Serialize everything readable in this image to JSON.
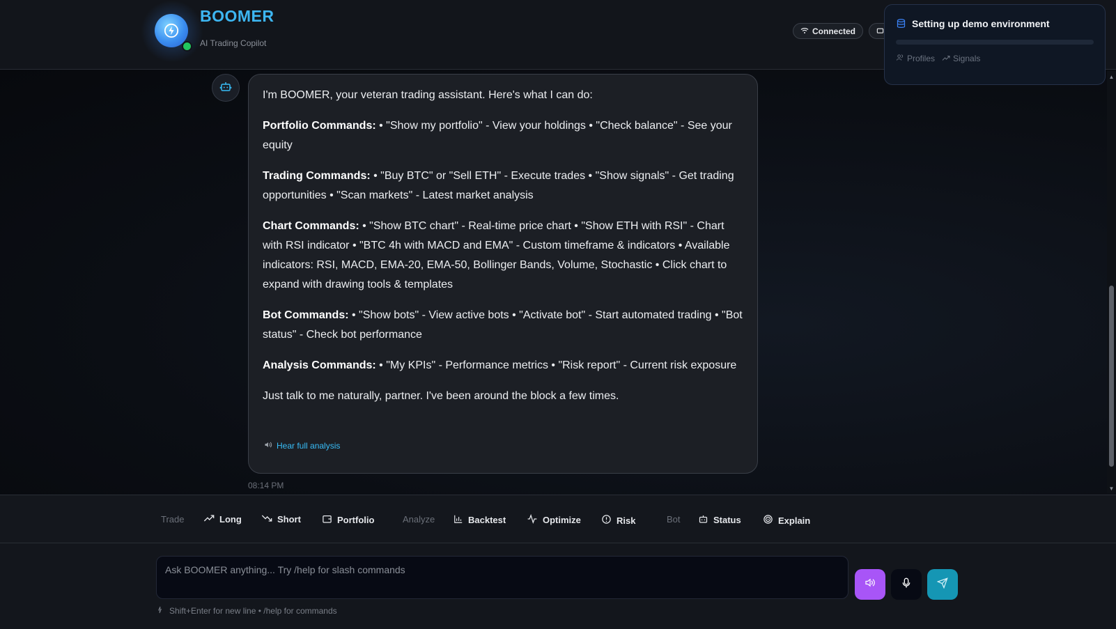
{
  "header": {
    "brand_title": "BOOMER",
    "brand_subtitle": "AI Trading Copilot",
    "connection_status": "Connected"
  },
  "toast": {
    "title": "Setting up demo environment",
    "progress": 0.0,
    "steps": [
      "Profiles",
      "Signals"
    ]
  },
  "message": {
    "intro": "I'm BOOMER, your veteran trading assistant. Here's what I can do:",
    "sections": [
      {
        "heading": "Portfolio Commands:",
        "body": " • \"Show my portfolio\" - View your holdings • \"Check balance\" - See your equity"
      },
      {
        "heading": "Trading Commands:",
        "body": " • \"Buy BTC\" or \"Sell ETH\" - Execute trades • \"Show signals\" - Get trading opportunities • \"Scan markets\" - Latest market analysis"
      },
      {
        "heading": "Chart Commands:",
        "body": " • \"Show BTC chart\" - Real-time price chart • \"Show ETH with RSI\" - Chart with RSI indicator • \"BTC 4h with MACD and EMA\" - Custom timeframe & indicators • Available indicators: RSI, MACD, EMA-20, EMA-50, Bollinger Bands, Volume, Stochastic • Click chart to expand with drawing tools & templates"
      },
      {
        "heading": "Bot Commands:",
        "body": " • \"Show bots\" - View active bots • \"Activate bot\" - Start automated trading • \"Bot status\" - Check bot performance"
      },
      {
        "heading": "Analysis Commands:",
        "body": " • \"My KPIs\" - Performance metrics • \"Risk report\" - Current risk exposure"
      }
    ],
    "closing": "Just talk to me naturally, partner. I've been around the block a few times.",
    "hear_label": "Hear full analysis",
    "timestamp": "08:14 PM"
  },
  "quick_actions": {
    "trade_label": "Trade",
    "long": "Long",
    "short": "Short",
    "portfolio": "Portfolio",
    "analyze_label": "Analyze",
    "backtest": "Backtest",
    "optimize": "Optimize",
    "risk": "Risk",
    "bot_label": "Bot",
    "status": "Status",
    "explain": "Explain"
  },
  "input": {
    "placeholder": "Ask BOOMER anything... Try /help for slash commands",
    "hint": "Shift+Enter for new line • /help for commands"
  },
  "colors": {
    "accent": "#3db6f2",
    "voice_button": "#a855f7",
    "send_button": "#1596b4",
    "online": "#22c55e"
  }
}
